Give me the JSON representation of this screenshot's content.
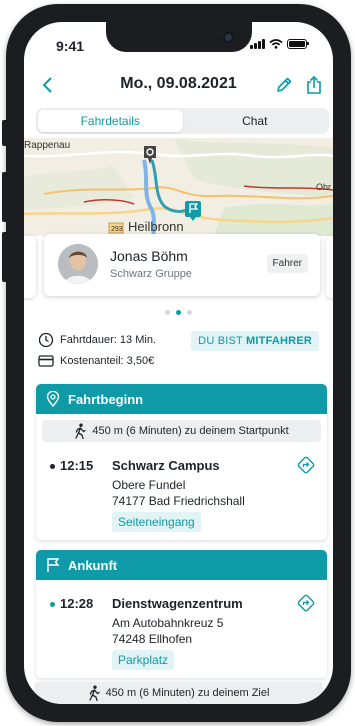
{
  "status": {
    "time": "9:41"
  },
  "nav": {
    "title": "Mo., 09.08.2021"
  },
  "tabs": [
    {
      "label": "Fahrdetails",
      "active": true
    },
    {
      "label": "Chat",
      "active": false
    }
  ],
  "map": {
    "labels": {
      "rappenau": "Rappenau",
      "heilbronn": "Heilbronn",
      "ohr": "Ohr",
      "road": "293"
    }
  },
  "driver": {
    "name": "Jonas Böhm",
    "company": "Schwarz Gruppe",
    "role": "Fahrer"
  },
  "pager": {
    "count": 3,
    "active_index": 1
  },
  "trip": {
    "duration": "Fahrtdauer: 13 Min.",
    "cost": "Kostenanteil: 3,50€",
    "role_tag_prefix": "DU BIST ",
    "role_tag_bold": "MITFAHRER"
  },
  "start": {
    "header": "Fahrtbeginn",
    "walk": "450 m (6 Minuten) zu deinem Startpunkt",
    "time": "12:15",
    "name": "Schwarz Campus",
    "street": "Obere Fundel",
    "city": "74177 Bad Friedrichshall",
    "tag": "Seiteneingang"
  },
  "arrival": {
    "header": "Ankunft",
    "time": "12:28",
    "name": "Dienstwagenzentrum",
    "street": "Am Autobahnkreuz 5",
    "city": "74248 Ellhofen",
    "tag": "Parkplatz"
  },
  "end_walk": "450 m (6 Minuten) zu deinem Ziel",
  "colors": {
    "accent": "#0f9aa8",
    "accent_light": "#e1f3f4",
    "bullet_dark": "#1d2329"
  }
}
